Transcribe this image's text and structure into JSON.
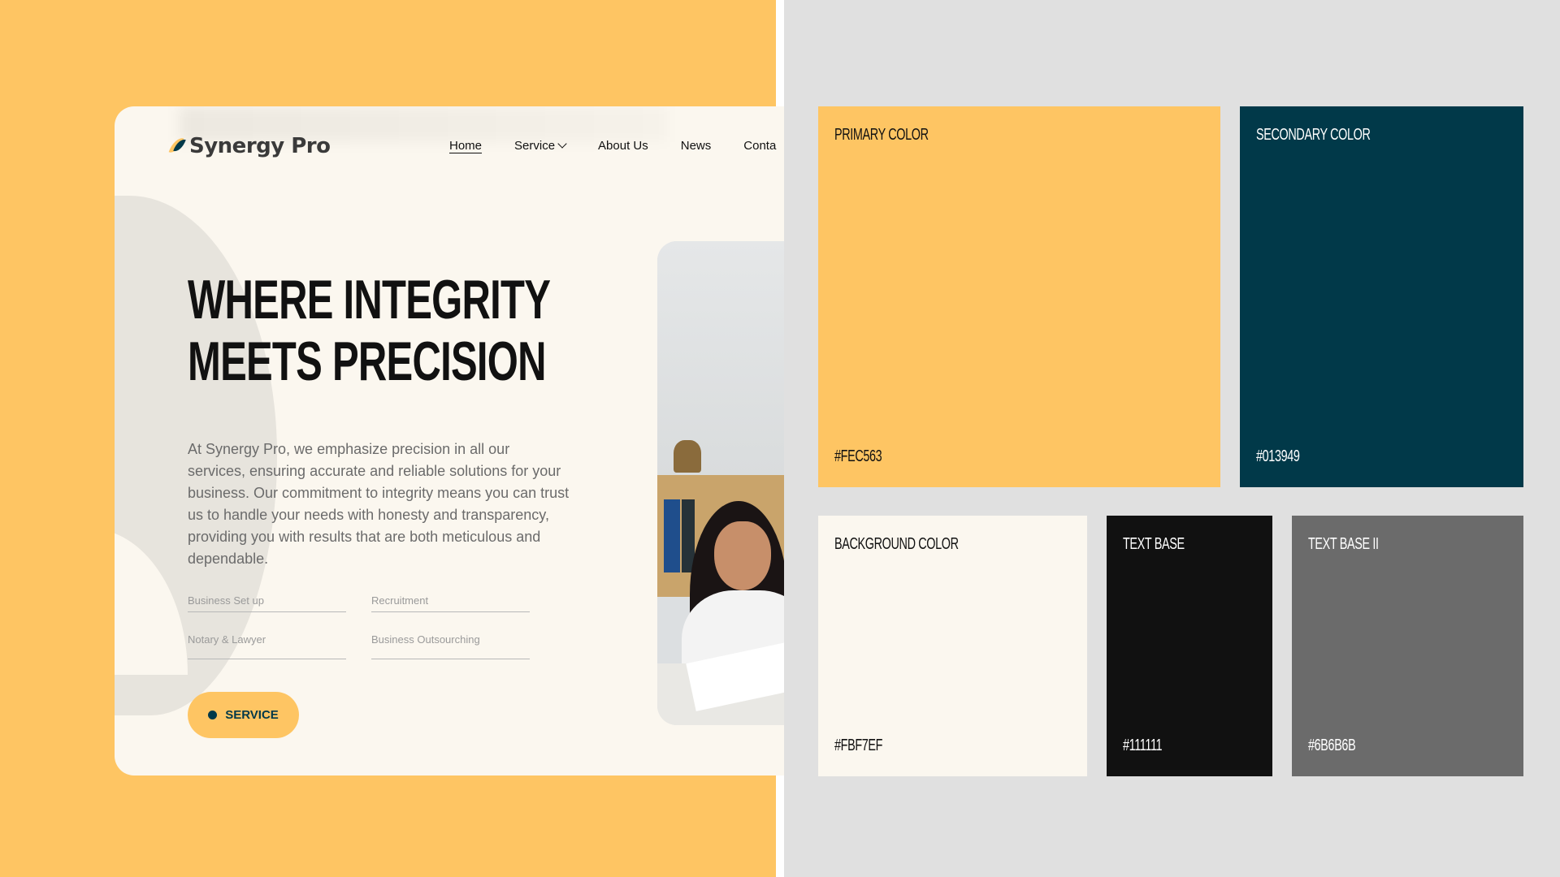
{
  "site": {
    "brand": "Synergy Pro",
    "nav": [
      "Home",
      "Service",
      "About Us",
      "News",
      "Conta"
    ],
    "headline_line1": "WHERE INTEGRITY",
    "headline_line2": "MEETS PRECISION",
    "body": "At Synergy Pro, we emphasize precision in all our services, ensuring accurate and reliable solutions for your business. Our commitment to integrity means you can trust us to handle your needs with honesty and transparency, providing you with results that are both meticulous and dependable.",
    "fields": [
      "Business Set up",
      "Recruitment",
      "Notary & Lawyer",
      "Business Outsourching"
    ],
    "cta_label": "SERVICE"
  },
  "palette": [
    {
      "label": "PRIMARY COLOR",
      "hex": "#FEC563"
    },
    {
      "label": "SECONDARY COLOR",
      "hex": "#013949"
    },
    {
      "label": "BACKGROUND COLOR",
      "hex": "#FBF7EF"
    },
    {
      "label": "TEXT BASE",
      "hex": "#111111"
    },
    {
      "label": "TEXT BASE II",
      "hex": "#6B6B6B"
    }
  ]
}
